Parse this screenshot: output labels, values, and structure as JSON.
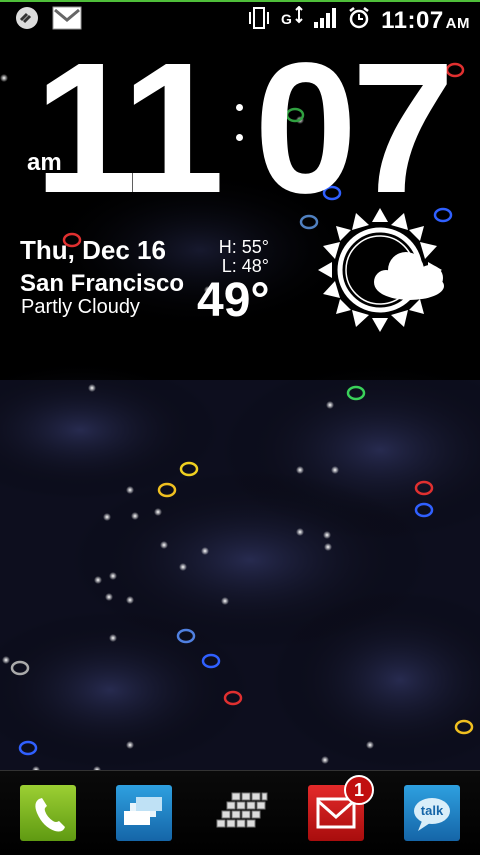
{
  "status_bar": {
    "time": "11:07",
    "ampm": "AM",
    "icons": [
      "link-icon",
      "gmail-icon",
      "vibrate-icon",
      "data-arrows-icon",
      "signal-icon",
      "alarm-icon"
    ]
  },
  "clock": {
    "hours": "11",
    "minutes": "07",
    "ampm": "am"
  },
  "weather": {
    "date": "Thu, Dec 16",
    "city": "San Francisco",
    "condition": "Partly Cloudy",
    "high": "H:  55°",
    "low": "L:  48°",
    "temp": "49°",
    "icon": "partly-cloudy-icon"
  },
  "dock": {
    "items": [
      {
        "name": "phone",
        "icon": "phone-icon",
        "color": "#7fbf1f"
      },
      {
        "name": "contacts",
        "icon": "contacts-icon",
        "color": "#1f86c8"
      },
      {
        "name": "app-drawer",
        "icon": "grid-icon",
        "color": "#cccccc"
      },
      {
        "name": "gmail",
        "icon": "gmail-icon",
        "color": "#d11b1b",
        "badge": "1"
      },
      {
        "name": "talk",
        "icon": "talk-icon",
        "color": "#1f86c8",
        "label": "talk"
      }
    ]
  }
}
